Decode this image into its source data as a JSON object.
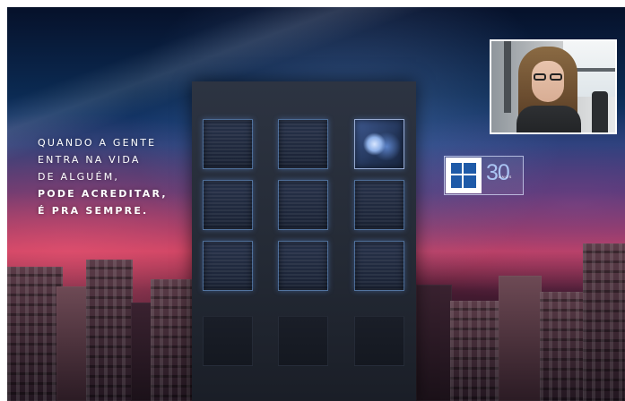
{
  "video": {
    "headline_lines": [
      "QUANDO A GENTE",
      "ENTRA NA VIDA",
      "DE ALGUÉM,",
      "PODE ACREDITAR,",
      "É PRA SEMPRE."
    ],
    "logo": {
      "years": "30",
      "anos": "ANOS",
      "brand_color": "#1e5aa8"
    }
  },
  "webcam": {
    "participant_icon": "person-video-feed"
  },
  "colors": {
    "sky_top": "#06112a",
    "sky_pink": "#c33d5d",
    "window_glow": "#6ea0dc"
  }
}
